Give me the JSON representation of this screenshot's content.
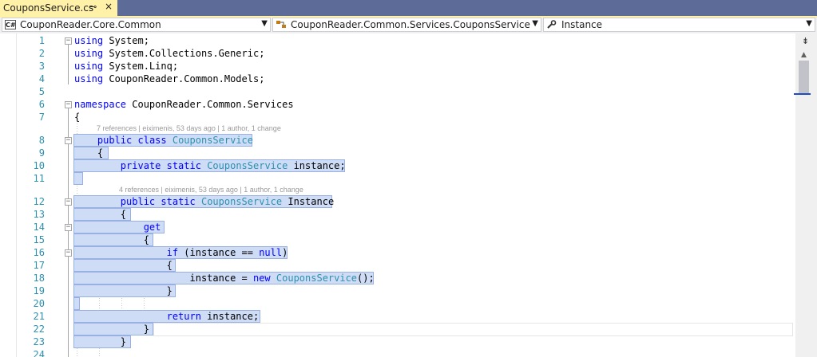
{
  "tab": {
    "title": "CouponsService.cs",
    "pin": "⊸",
    "close": "×"
  },
  "nav": {
    "project": "CouponReader.Core.Common",
    "project_icon": "C#",
    "type": "CouponReader.Common.Services.CouponsService",
    "member": "Instance",
    "member_icon": "wrench-icon"
  },
  "codelens": [
    "7 references | eiximenis, 53 days ago | 1 author, 1 change",
    "4 references | eiximenis, 53 days ago | 1 author, 1 change"
  ],
  "line_numbers": [
    "1",
    "2",
    "3",
    "4",
    "5",
    "6",
    "7",
    "8",
    "9",
    "10",
    "11",
    "12",
    "13",
    "14",
    "15",
    "16",
    "17",
    "18",
    "19",
    "20",
    "21",
    "22",
    "23",
    "24"
  ],
  "code_lines": [
    [
      {
        "t": "using",
        "c": "kw"
      },
      {
        "t": " System;"
      }
    ],
    [
      {
        "t": "using",
        "c": "kw"
      },
      {
        "t": " System.Collections.Generic;"
      }
    ],
    [
      {
        "t": "using",
        "c": "kw"
      },
      {
        "t": " System.Linq;"
      }
    ],
    [
      {
        "t": "using",
        "c": "kw"
      },
      {
        "t": " CouponReader.Common.Models;"
      }
    ],
    [],
    [
      {
        "t": "namespace",
        "c": "kw"
      },
      {
        "t": " CouponReader.Common.Services"
      }
    ],
    [
      {
        "t": "{"
      }
    ],
    [
      {
        "t": "    "
      },
      {
        "t": "public",
        "c": "kw"
      },
      {
        "t": " "
      },
      {
        "t": "class",
        "c": "kw"
      },
      {
        "t": " "
      },
      {
        "t": "CouponsService",
        "c": "ty"
      }
    ],
    [
      {
        "t": "    {"
      }
    ],
    [
      {
        "t": "        "
      },
      {
        "t": "private",
        "c": "kw"
      },
      {
        "t": " "
      },
      {
        "t": "static",
        "c": "kw"
      },
      {
        "t": " "
      },
      {
        "t": "CouponsService",
        "c": "ty"
      },
      {
        "t": " instance;"
      }
    ],
    [],
    [
      {
        "t": "        "
      },
      {
        "t": "public",
        "c": "kw"
      },
      {
        "t": " "
      },
      {
        "t": "static",
        "c": "kw"
      },
      {
        "t": " "
      },
      {
        "t": "CouponsService",
        "c": "ty"
      },
      {
        "t": " Instance"
      }
    ],
    [
      {
        "t": "        {"
      }
    ],
    [
      {
        "t": "            "
      },
      {
        "t": "get",
        "c": "kw"
      }
    ],
    [
      {
        "t": "            {"
      }
    ],
    [
      {
        "t": "                "
      },
      {
        "t": "if",
        "c": "kw"
      },
      {
        "t": " (instance == "
      },
      {
        "t": "null",
        "c": "kw"
      },
      {
        "t": ")"
      }
    ],
    [
      {
        "t": "                {"
      }
    ],
    [
      {
        "t": "                    instance = "
      },
      {
        "t": "new",
        "c": "kw"
      },
      {
        "t": " "
      },
      {
        "t": "CouponsService",
        "c": "ty"
      },
      {
        "t": "();"
      }
    ],
    [
      {
        "t": "                }"
      }
    ],
    [],
    [
      {
        "t": "                "
      },
      {
        "t": "return",
        "c": "kw"
      },
      {
        "t": " instance;"
      }
    ],
    [
      {
        "t": "            }"
      }
    ],
    [
      {
        "t": "        }"
      }
    ],
    []
  ]
}
